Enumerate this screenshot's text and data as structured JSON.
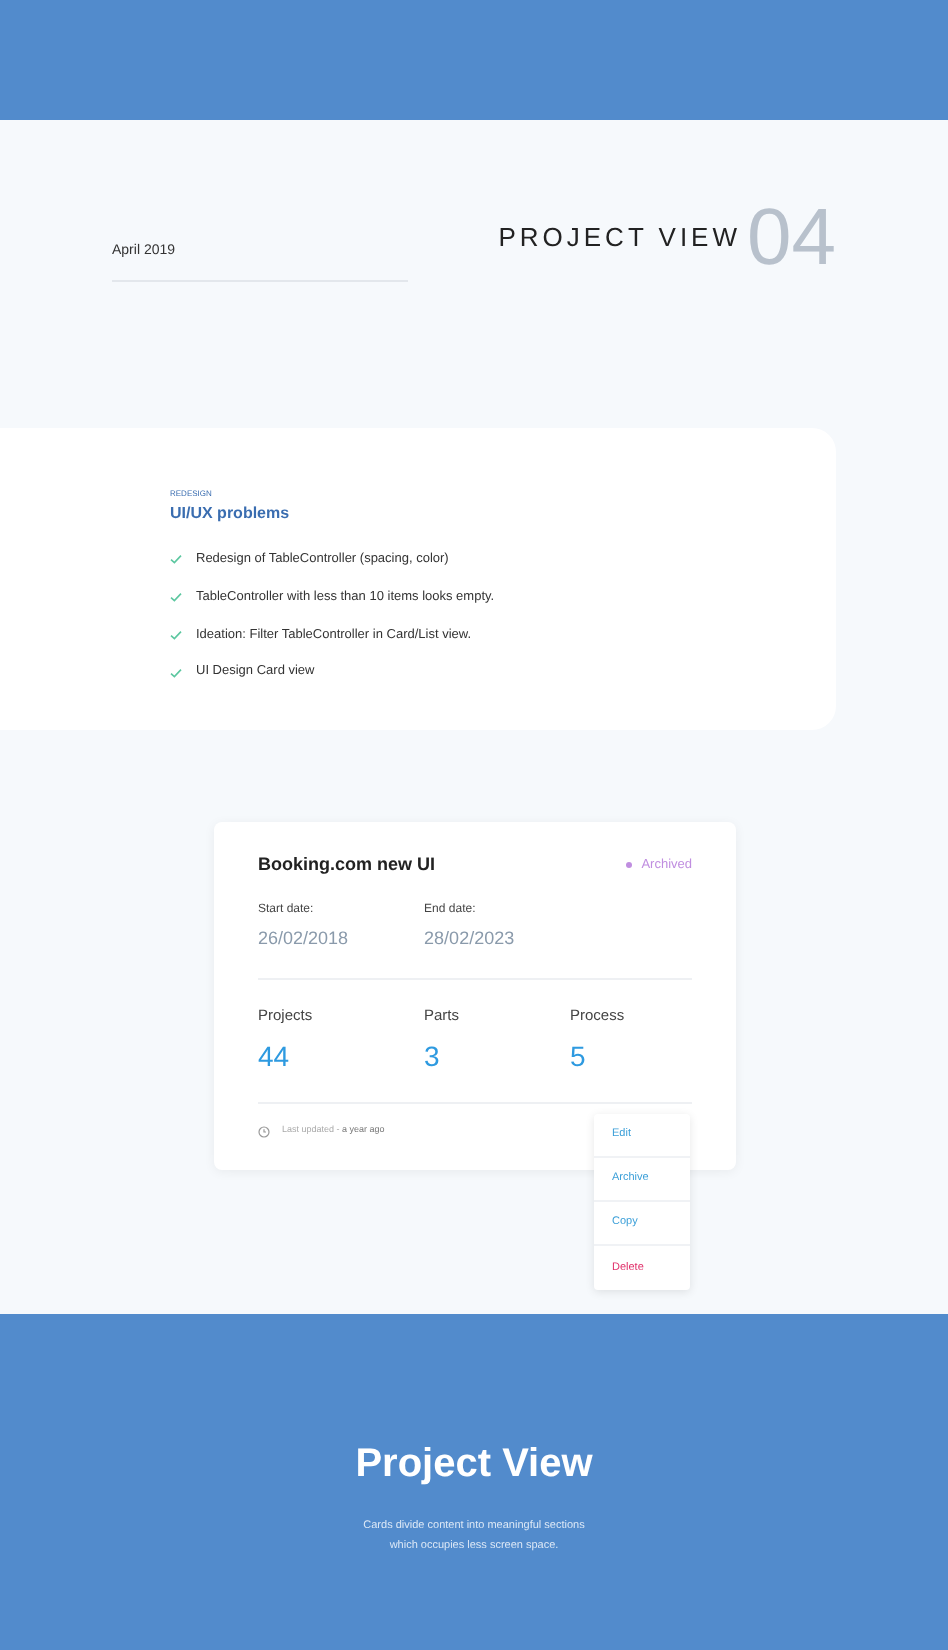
{
  "header": {
    "date": "April 2019",
    "title": "PROJECT VIEW",
    "number": "04"
  },
  "problems": {
    "eyebrow": "REDESIGN",
    "title": "UI/UX problems",
    "items": [
      {
        "text": "Redesign of TableController (spacing, color)",
        "checked": true
      },
      {
        "text": "TableController with less than 10 items looks empty.",
        "checked": true
      },
      {
        "text": "Ideation: Filter TableController in Card/List view.",
        "checked": true
      },
      {
        "text": "UI Design Card view",
        "checked": true
      }
    ]
  },
  "project_card": {
    "title": "Booking.com new UI",
    "status": {
      "label": "Archived",
      "color": "#c08ee0"
    },
    "dates": [
      {
        "label": "Start date:",
        "value": "26/02/2018"
      },
      {
        "label": "End date:",
        "value": "28/02/2023"
      }
    ],
    "stats": [
      {
        "label": "Projects",
        "value": "44"
      },
      {
        "label": "Parts",
        "value": "3"
      },
      {
        "label": "Process",
        "value": "5"
      }
    ],
    "footer": {
      "label": "Last updated - ",
      "value": "a year ago"
    },
    "menu": [
      {
        "label": "Edit",
        "kind": "normal"
      },
      {
        "label": "Archive",
        "kind": "normal"
      },
      {
        "label": "Copy",
        "kind": "normal"
      },
      {
        "label": "Delete",
        "kind": "danger"
      }
    ]
  },
  "footer_band": {
    "title": "Project View",
    "lines": [
      "Cards divide content into meaningful sections",
      "which occupies less screen space."
    ]
  }
}
